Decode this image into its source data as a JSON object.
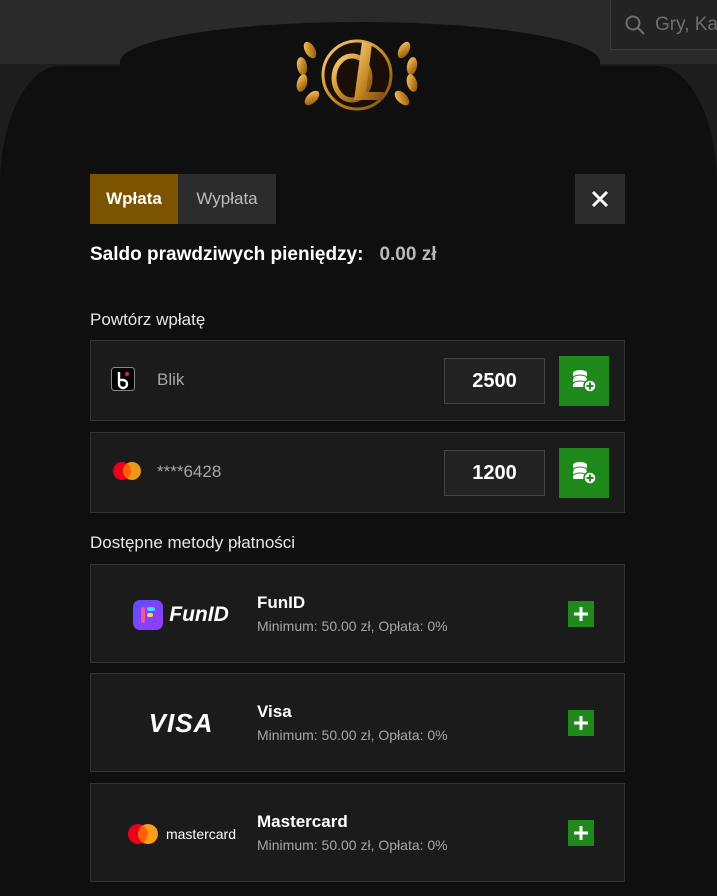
{
  "search": {
    "placeholder": "Gry, Ka"
  },
  "tabs": [
    {
      "label": "Wpłata",
      "active": true
    },
    {
      "label": "Wypłata",
      "active": false
    }
  ],
  "balance": {
    "label": "Saldo prawdziwych pieniędzy:",
    "value": "0.00 zł"
  },
  "repeat_section": {
    "title": "Powtórz wpłatę",
    "items": [
      {
        "icon": "blik-icon",
        "label": "Blik",
        "amount": "2500"
      },
      {
        "icon": "mastercard-icon",
        "label": "****6428",
        "amount": "1200"
      }
    ]
  },
  "methods_section": {
    "title": "Dostępne metody płatności",
    "items": [
      {
        "logo": "FunID",
        "name": "FunID",
        "info": "Minimum: 50.00 zł, Opłata: 0%"
      },
      {
        "logo": "VISA",
        "name": "Visa",
        "info": "Minimum: 50.00 zł, Opłata: 0%"
      },
      {
        "logo": "mastercard",
        "name": "Mastercard",
        "info": "Minimum: 50.00 zł, Opłata: 0%"
      }
    ]
  },
  "colors": {
    "accent_gold": "#7c5400",
    "green": "#1f8a1b",
    "modal_bg": "#0f0f0f"
  }
}
